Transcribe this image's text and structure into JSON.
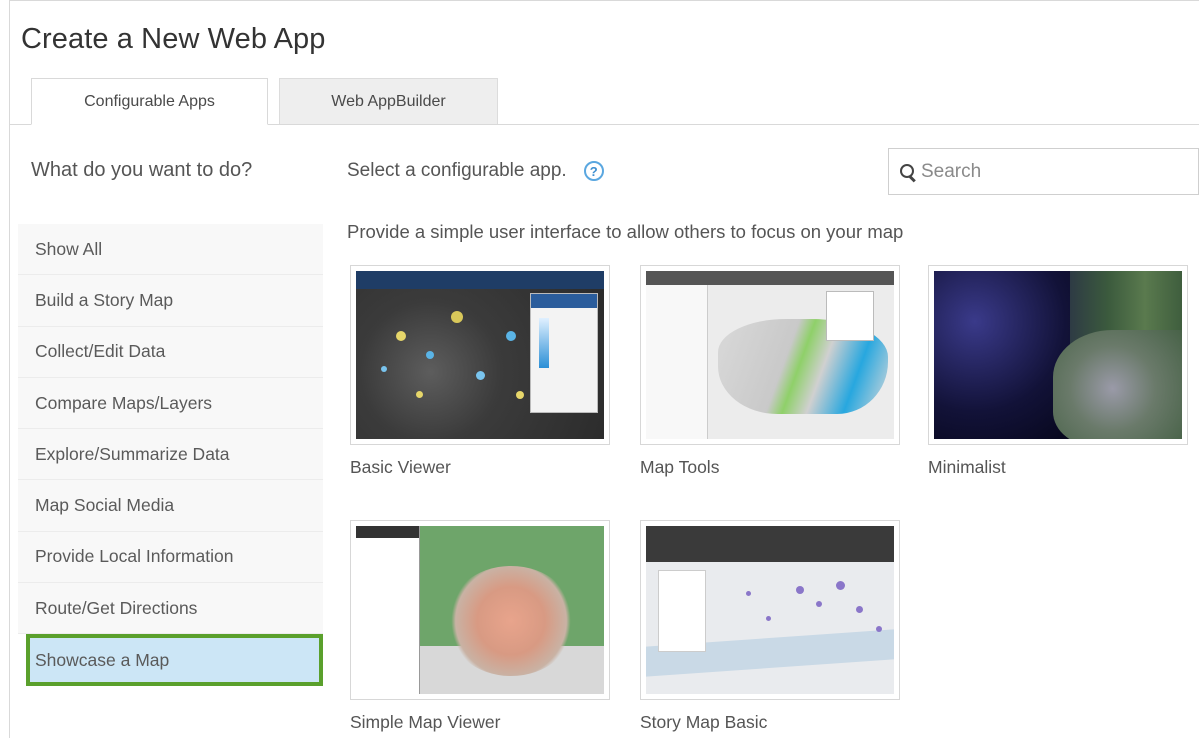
{
  "dialog": {
    "title": "Create a New Web App"
  },
  "tabs": [
    {
      "label": "Configurable Apps",
      "active": true
    },
    {
      "label": "Web AppBuilder",
      "active": false
    }
  ],
  "sidebar": {
    "heading": "What do you want to do?",
    "items": [
      {
        "label": "Show All"
      },
      {
        "label": "Build a Story Map"
      },
      {
        "label": "Collect/Edit Data"
      },
      {
        "label": "Compare Maps/Layers"
      },
      {
        "label": "Explore/Summarize Data"
      },
      {
        "label": "Map Social Media"
      },
      {
        "label": "Provide Local Information"
      },
      {
        "label": "Route/Get Directions"
      },
      {
        "label": "Showcase a Map",
        "selected": true
      }
    ]
  },
  "main": {
    "heading": "Select a configurable app.",
    "help_icon": "?",
    "search": {
      "placeholder": "Search"
    },
    "description": "Provide a simple user interface to allow others to focus on your map",
    "apps": [
      {
        "label": "Basic Viewer",
        "thumbnail": "basic-viewer-thumbnail"
      },
      {
        "label": "Map Tools",
        "thumbnail": "map-tools-thumbnail"
      },
      {
        "label": "Minimalist",
        "thumbnail": "minimalist-thumbnail"
      },
      {
        "label": "Simple Map Viewer",
        "thumbnail": "simple-map-viewer-thumbnail"
      },
      {
        "label": "Story Map Basic",
        "thumbnail": "story-map-basic-thumbnail"
      }
    ]
  },
  "colors": {
    "selected_bg": "#cce6f6",
    "selected_outline": "#5aa02c",
    "help_icon": "#3e8fd0"
  }
}
